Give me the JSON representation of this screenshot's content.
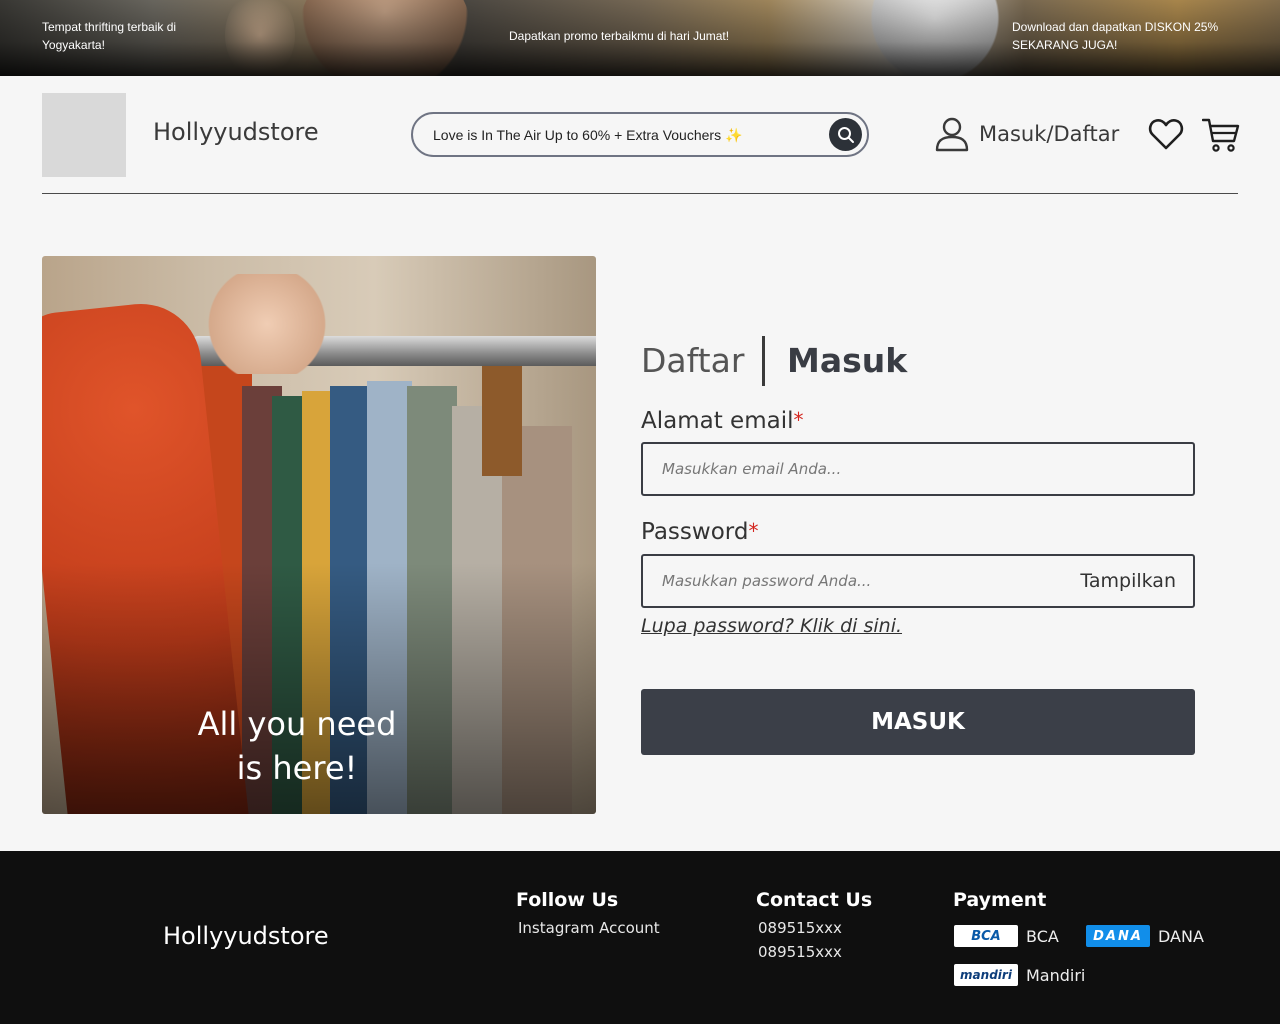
{
  "promo": {
    "left": "Tempat thrifting terbaik di Yogyakarta!",
    "middle": "Dapatkan promo terbaikmu di hari Jumat!",
    "right": "Download dan dapatkan DISKON 25% SEKARANG JUGA!"
  },
  "header": {
    "brand": "Hollyyudstore",
    "search_value": "Love is In The Air Up to 60% + Extra Vouchers ✨",
    "login_label": "Masuk/Daftar"
  },
  "hero": {
    "caption_line1": "All you need",
    "caption_line2": "is here!"
  },
  "form": {
    "tab_register": "Daftar",
    "tab_login": "Masuk",
    "email_label": "Alamat email",
    "email_placeholder": "Masukkan email Anda...",
    "password_label": "Password",
    "password_placeholder": "Masukkan password Anda...",
    "required_mark": "*",
    "show_password": "Tampilkan",
    "forgot": "Lupa password? Klik di sini.",
    "submit": "MASUK"
  },
  "footer": {
    "brand": "Hollyyudstore",
    "follow_title": "Follow Us",
    "follow_item": "Instagram Account",
    "contact_title": "Contact Us",
    "contacts": [
      "089515xxx",
      "089515xxx"
    ],
    "payment_title": "Payment",
    "payments": [
      {
        "logo": "BCA",
        "name": "BCA"
      },
      {
        "logo": "DANA",
        "name": "DANA"
      },
      {
        "logo": "mandiri",
        "name": "Mandiri"
      }
    ]
  },
  "colors": {
    "primary_button": "#3b3f48",
    "required": "#d4261f",
    "footer_bg": "#0f0f0f",
    "page_bg": "#f6f6f6"
  }
}
